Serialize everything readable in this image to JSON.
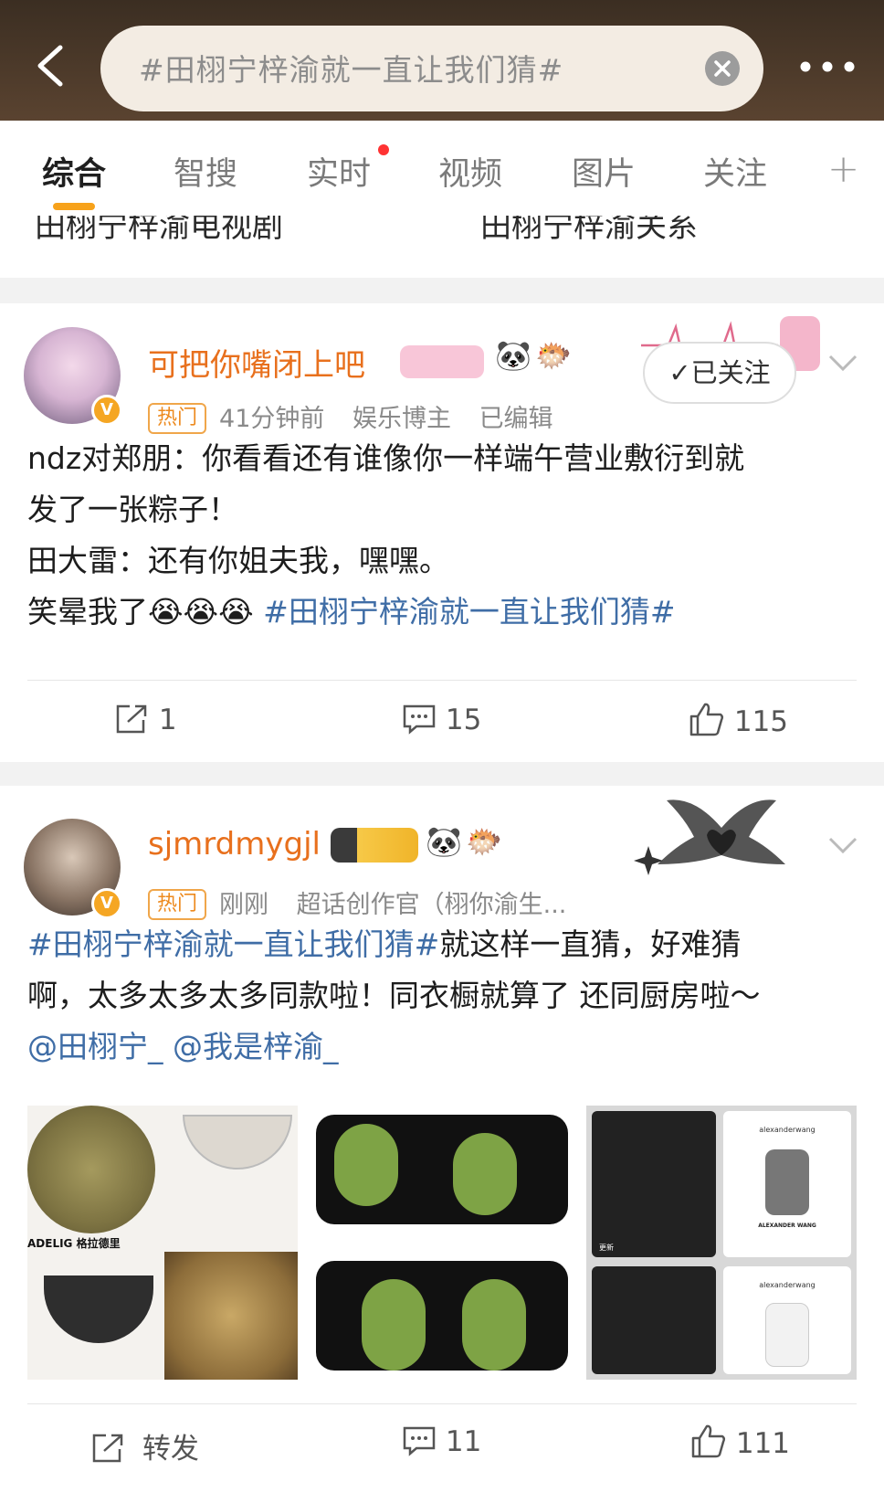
{
  "header": {
    "search_text": "#田栩宁梓渝就一直让我们猜#"
  },
  "tabs": [
    {
      "label": "综合"
    },
    {
      "label": "智搜"
    },
    {
      "label": "实时"
    },
    {
      "label": "视频"
    },
    {
      "label": "图片"
    },
    {
      "label": "关注"
    }
  ],
  "related": [
    "田栩宁梓渝电视剧",
    "田栩宁梓渝关系"
  ],
  "post1": {
    "username": "可把你嘴闭上吧",
    "hot_badge": "热门",
    "time": "41分钟前",
    "role": "娱乐博主",
    "edited": "已编辑",
    "follow_label": "已关注",
    "lines": [
      "ndz对郑朋：你看看还有谁像你一样端午营业敷衍到就",
      "发了一张粽子！",
      "田大雷：还有你姐夫我，嘿嘿。",
      "笑晕我了"
    ],
    "emoji": "😭😭😭",
    "hashtag": " #田栩宁梓渝就一直让我们猜#",
    "reposts": "1",
    "comments": "15",
    "likes": "115"
  },
  "post2": {
    "username": "sjmrdmygjl",
    "hot_badge": "热门",
    "time": "刚刚",
    "role": "超话创作官（栩你渝生...",
    "hashtag": "#田栩宁梓渝就一直让我们猜#",
    "line1_rest": "就这样一直猜，好难猜",
    "line2": "啊，太多太多太多同款啦！同衣橱就算了 还同厨房啦～",
    "mention1": "@田栩宁_",
    "mention2": "@我是梓渝_",
    "image_texts": {
      "brand_a": "ADELIG 格拉德里",
      "brand_b": "alexanderwang",
      "brand_c": "ALEXANDER WANG",
      "update": "更新"
    },
    "repost_label": "转发",
    "comments": "11",
    "likes": "111"
  },
  "colors": {
    "accent": "#f7a21b",
    "link": "#3f6da6",
    "username": "#e8701d"
  }
}
